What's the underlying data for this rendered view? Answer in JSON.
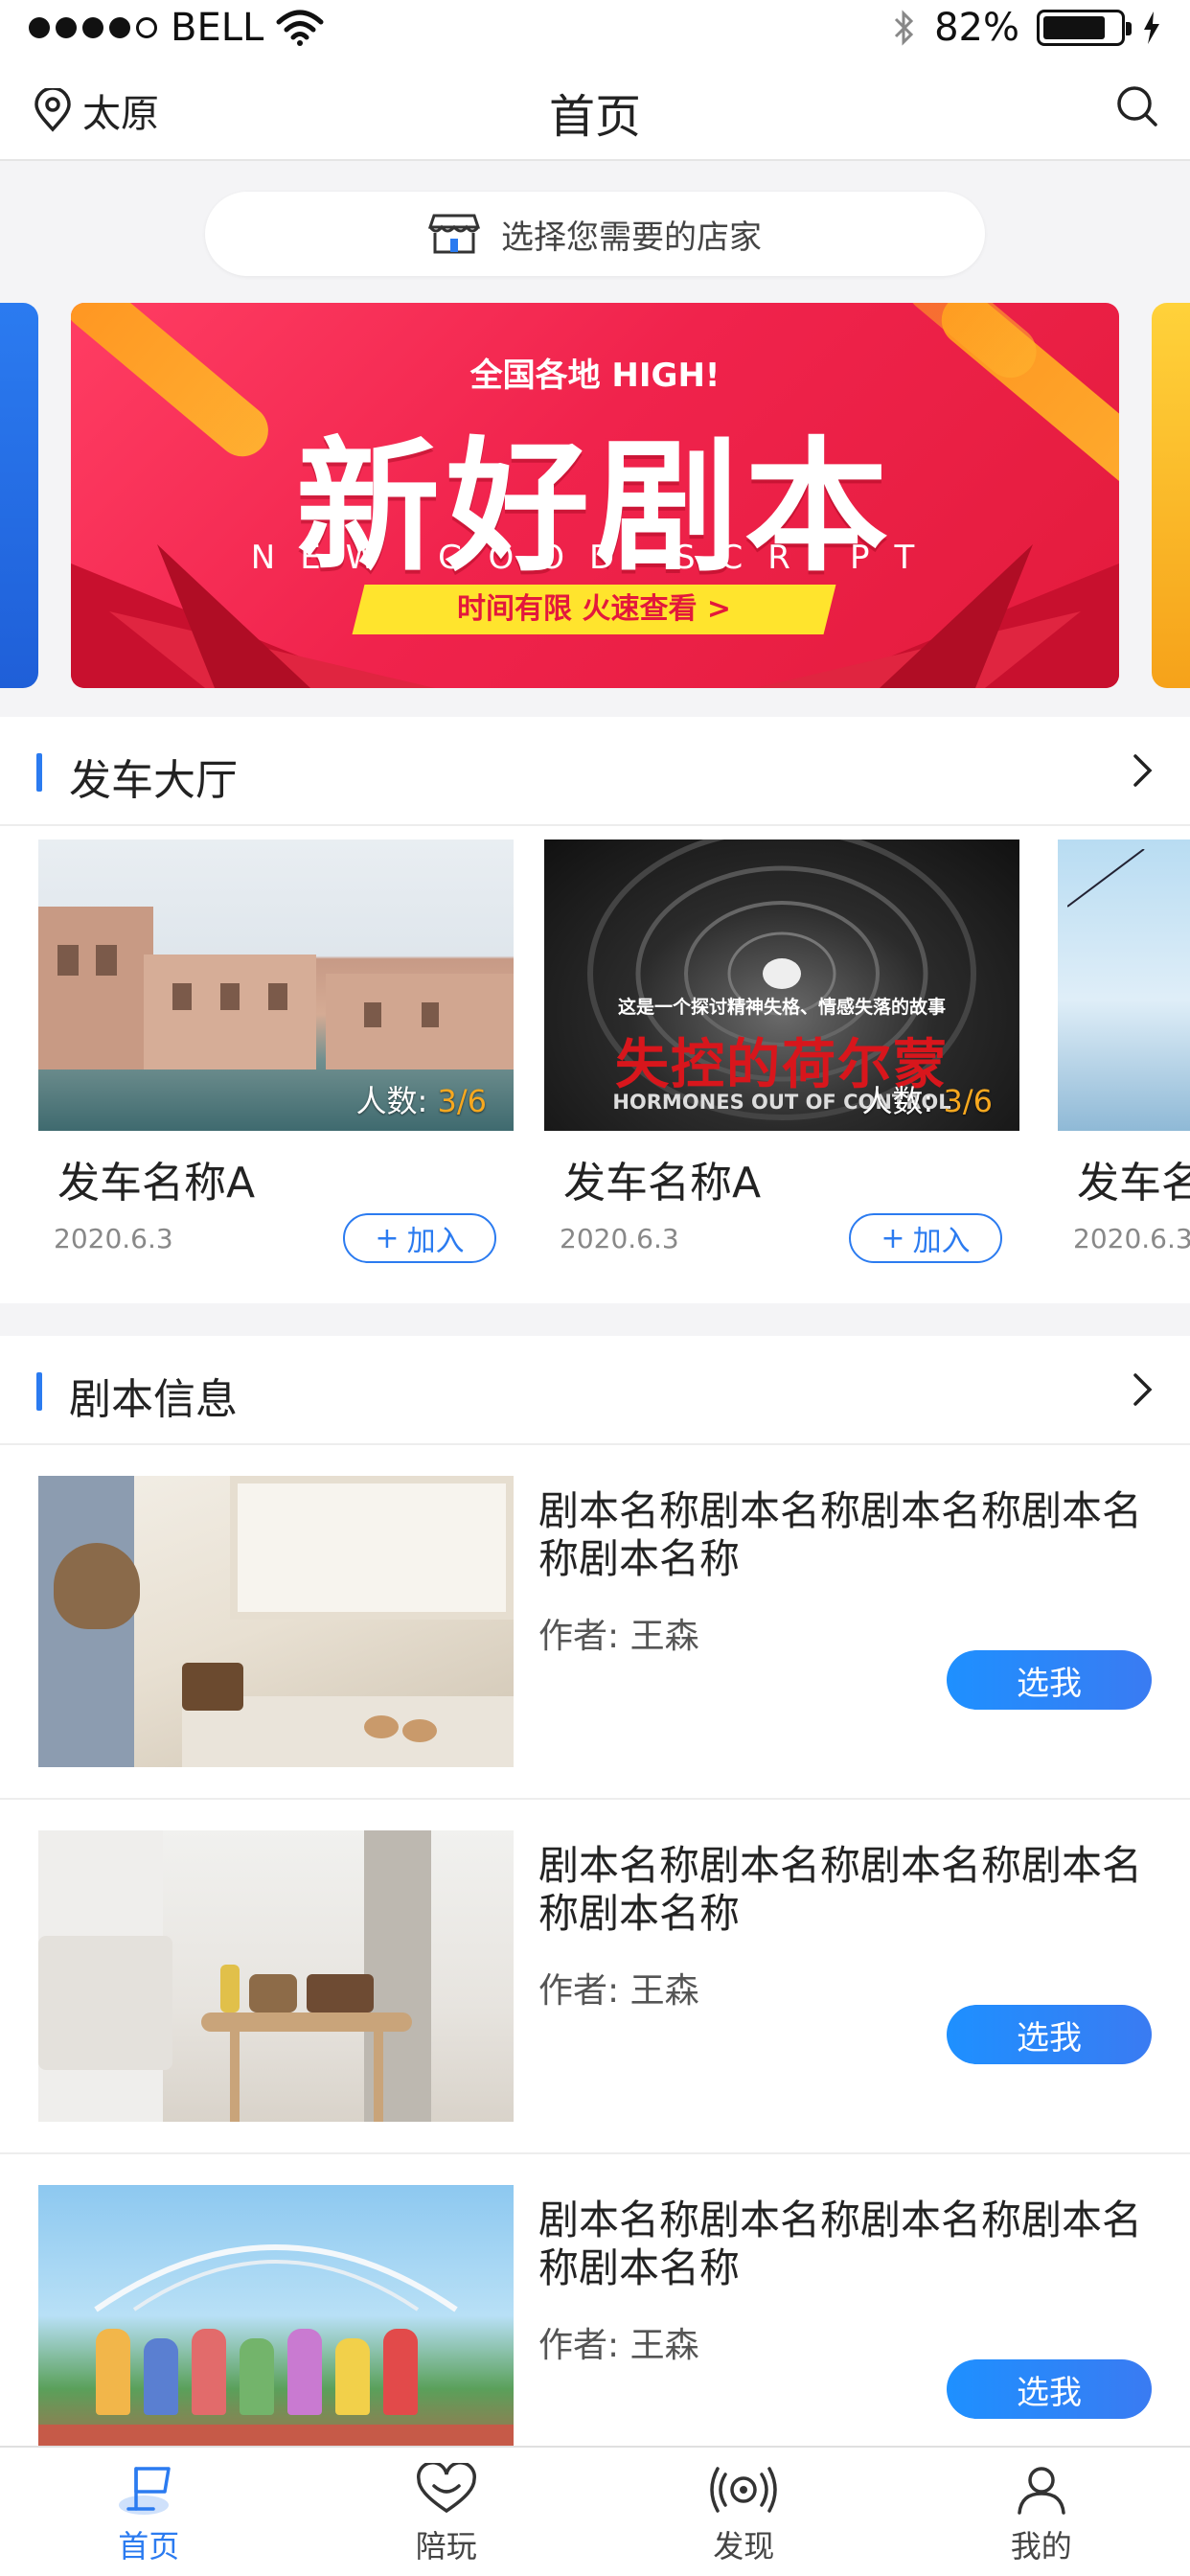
{
  "status_bar": {
    "carrier": "BELL",
    "battery": "82%",
    "battery_level": 0.82
  },
  "nav": {
    "city": "太原",
    "title": "首页"
  },
  "store_selector": {
    "label": "选择您需要的店家"
  },
  "banner": {
    "tagline": "全国各地 HIGH!",
    "title": "新好剧本",
    "subtitle_en": "NEW GOOD SCRIPT",
    "cta": "时间有限  火速查看 >"
  },
  "departure": {
    "title": "发车大厅",
    "cards": [
      {
        "name": "发车名称A",
        "date": "2020.6.3",
        "count_label": "人数:",
        "count": "3/6",
        "join": "加入"
      },
      {
        "name": "发车名称A",
        "date": "2020.6.3",
        "count_label": "人数:",
        "count": "3/6",
        "join": "加入",
        "poster_text_top": "这是一个探讨精神失格、情感失落的故事",
        "poster_text_main": "失控的荷尔蒙",
        "poster_text_en": "HORMONES OUT OF CONTROL"
      },
      {
        "name": "发车名",
        "date": "2020.6.3"
      }
    ]
  },
  "scripts": {
    "title": "剧本信息",
    "items": [
      {
        "title": "剧本名称剧本名称剧本名称剧本名称剧本名称",
        "author_label": "作者:",
        "author": "王森",
        "button": "选我"
      },
      {
        "title": "剧本名称剧本名称剧本名称剧本名称剧本名称",
        "author_label": "作者:",
        "author": "王森",
        "button": "选我"
      },
      {
        "title": "剧本名称剧本名称剧本名称剧本名称剧本名称",
        "author_label": "作者:",
        "author": "王森",
        "button": "选我"
      }
    ]
  },
  "tabs": [
    {
      "label": "首页",
      "icon": "home-flag-icon",
      "active": true
    },
    {
      "label": "陪玩",
      "icon": "heart-icon",
      "active": false
    },
    {
      "label": "发现",
      "icon": "broadcast-icon",
      "active": false
    },
    {
      "label": "我的",
      "icon": "user-icon",
      "active": false
    }
  ],
  "colors": {
    "accent": "#2b7bf0",
    "count_highlight": "#f7a81f",
    "banner_red": "#f0234c",
    "banner_cta_bg": "#ffe42d"
  }
}
